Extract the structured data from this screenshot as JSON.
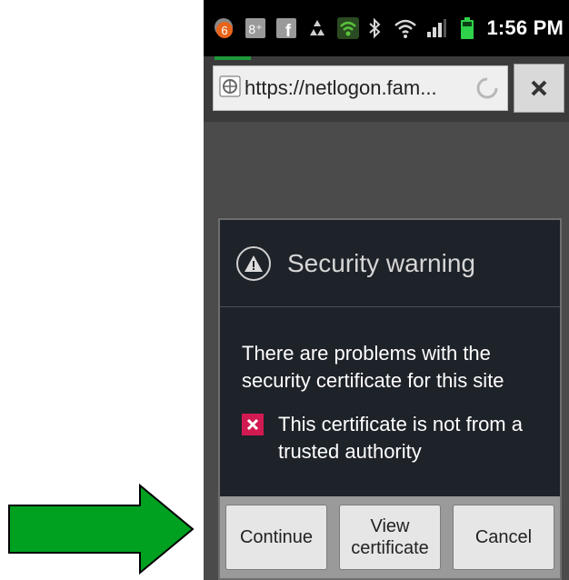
{
  "status_bar": {
    "time": "1:56 PM",
    "notification_badge": "6",
    "icons_left": [
      "notification-badge-icon",
      "google-plus-icon",
      "facebook-icon",
      "recycle-icon",
      "wifi-hotspot-icon"
    ],
    "icons_right": [
      "bluetooth-icon",
      "wifi-icon",
      "signal-icon",
      "battery-icon"
    ],
    "colors": {
      "background": "#000000",
      "battery": "#2fd04a",
      "hotspot": "#58c23a"
    }
  },
  "browser": {
    "url": "https://netlogon.fam...",
    "loading": true,
    "progress_color": "#1d9a3a"
  },
  "dialog": {
    "title": "Security warning",
    "message": "There are problems with the security certificate for this site",
    "warnings": [
      "This certificate is not from a trusted authority"
    ],
    "buttons": {
      "continue": "Continue",
      "view_certificate_line1": "View",
      "view_certificate_line2": "certificate",
      "cancel": "Cancel"
    },
    "colors": {
      "background": "#1e2229",
      "warning_x": "#d21a52"
    }
  },
  "annotation": {
    "arrow_color": "#00a020",
    "arrow_points_to": "continue"
  }
}
